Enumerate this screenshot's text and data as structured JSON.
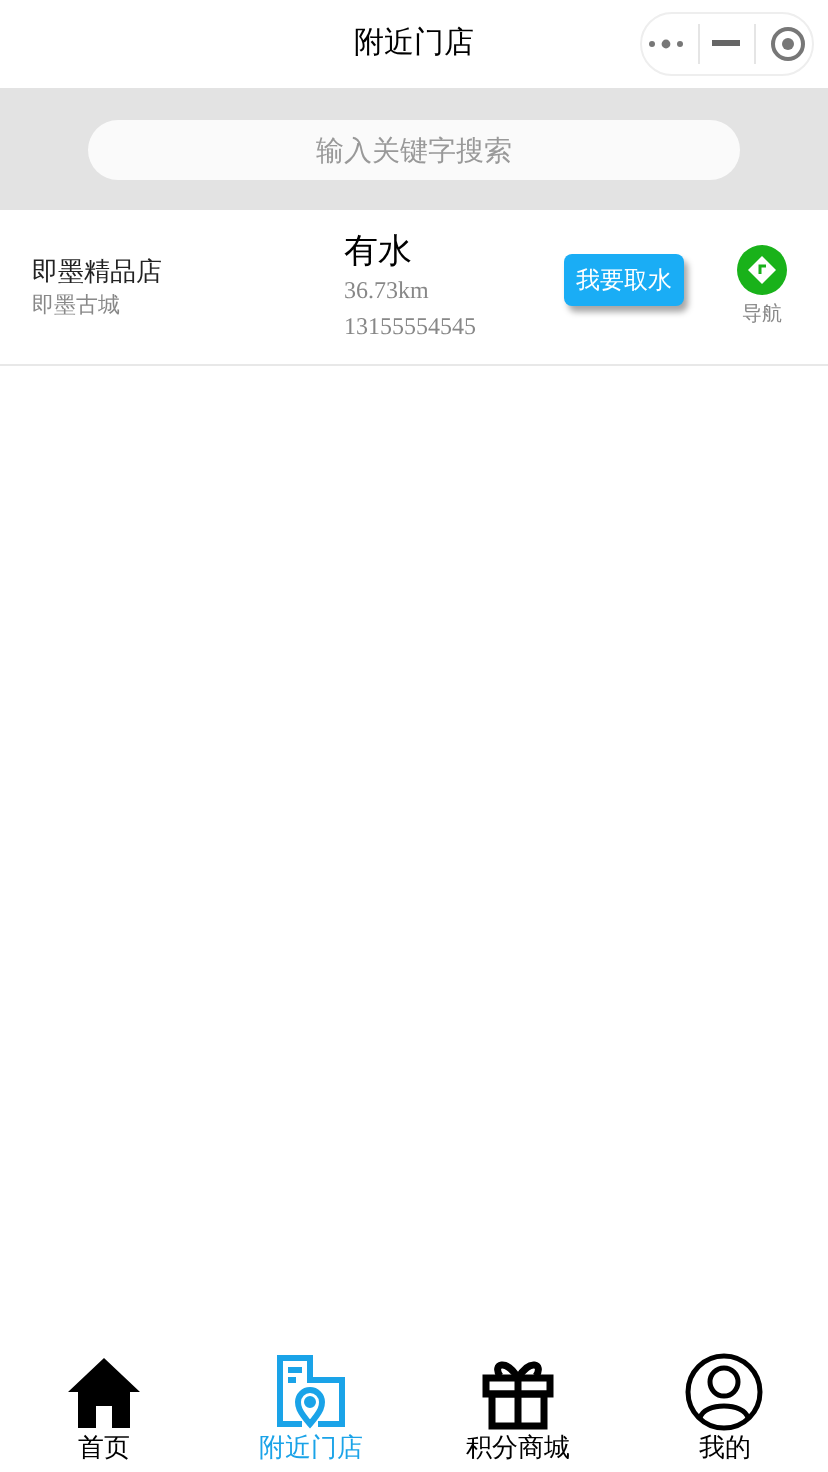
{
  "header": {
    "title": "附近门店"
  },
  "search": {
    "placeholder": "输入关键字搜索"
  },
  "stores": [
    {
      "name": "即墨精品店",
      "area": "即墨古城",
      "status": "有水",
      "distance": "36.73km",
      "phone": "13155554545",
      "action": "我要取水",
      "nav_label": "导航"
    }
  ],
  "tabs": [
    {
      "kind": "home",
      "label": "首页",
      "selected": false
    },
    {
      "kind": "store",
      "label": "附近门店",
      "selected": true
    },
    {
      "kind": "gift",
      "label": "积分商城",
      "selected": false
    },
    {
      "kind": "user",
      "label": "我的",
      "selected": false
    }
  ]
}
